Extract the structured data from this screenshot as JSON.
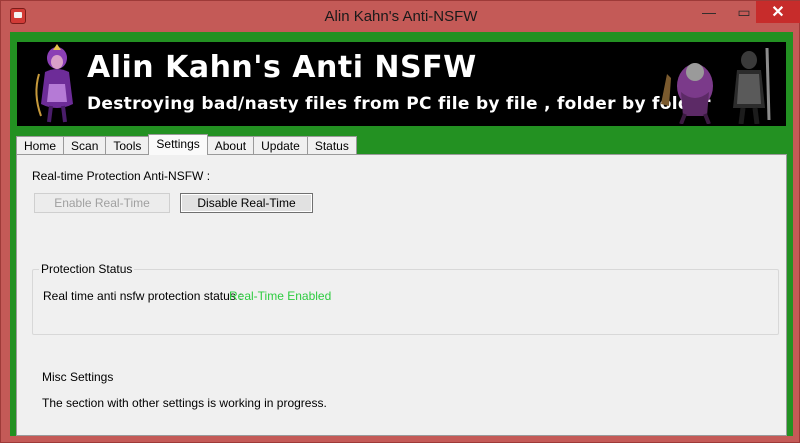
{
  "window": {
    "title": "Alin Kahn's Anti-NSFW",
    "controls": {
      "minimize": "—",
      "maximize": "▭",
      "close": "✕"
    }
  },
  "banner": {
    "heading": "Alin Kahn's Anti NSFW",
    "subheading": "Destroying bad/nasty files from PC file by file , folder by folder"
  },
  "tabs": [
    {
      "label": "Home"
    },
    {
      "label": "Scan"
    },
    {
      "label": "Tools"
    },
    {
      "label": "Settings",
      "active": true
    },
    {
      "label": "About"
    },
    {
      "label": "Update"
    },
    {
      "label": "Status"
    }
  ],
  "settings": {
    "realtime_label": "Real-time Protection Anti-NSFW :",
    "enable_button": "Enable Real-Time",
    "disable_button": "Disable Real-Time",
    "protection_group": {
      "title": "Protection Status",
      "status_label": "Real time anti nsfw protection status :",
      "status_value": "Real-Time Enabled",
      "status_color": "#2ecc40"
    },
    "misc": {
      "title": "Misc Settings",
      "text": "The section with other settings is working in progress."
    }
  },
  "colors": {
    "frame": "#c45a57",
    "client_background": "#239122",
    "banner_background": "#000000",
    "close_button": "#c72c2b"
  }
}
